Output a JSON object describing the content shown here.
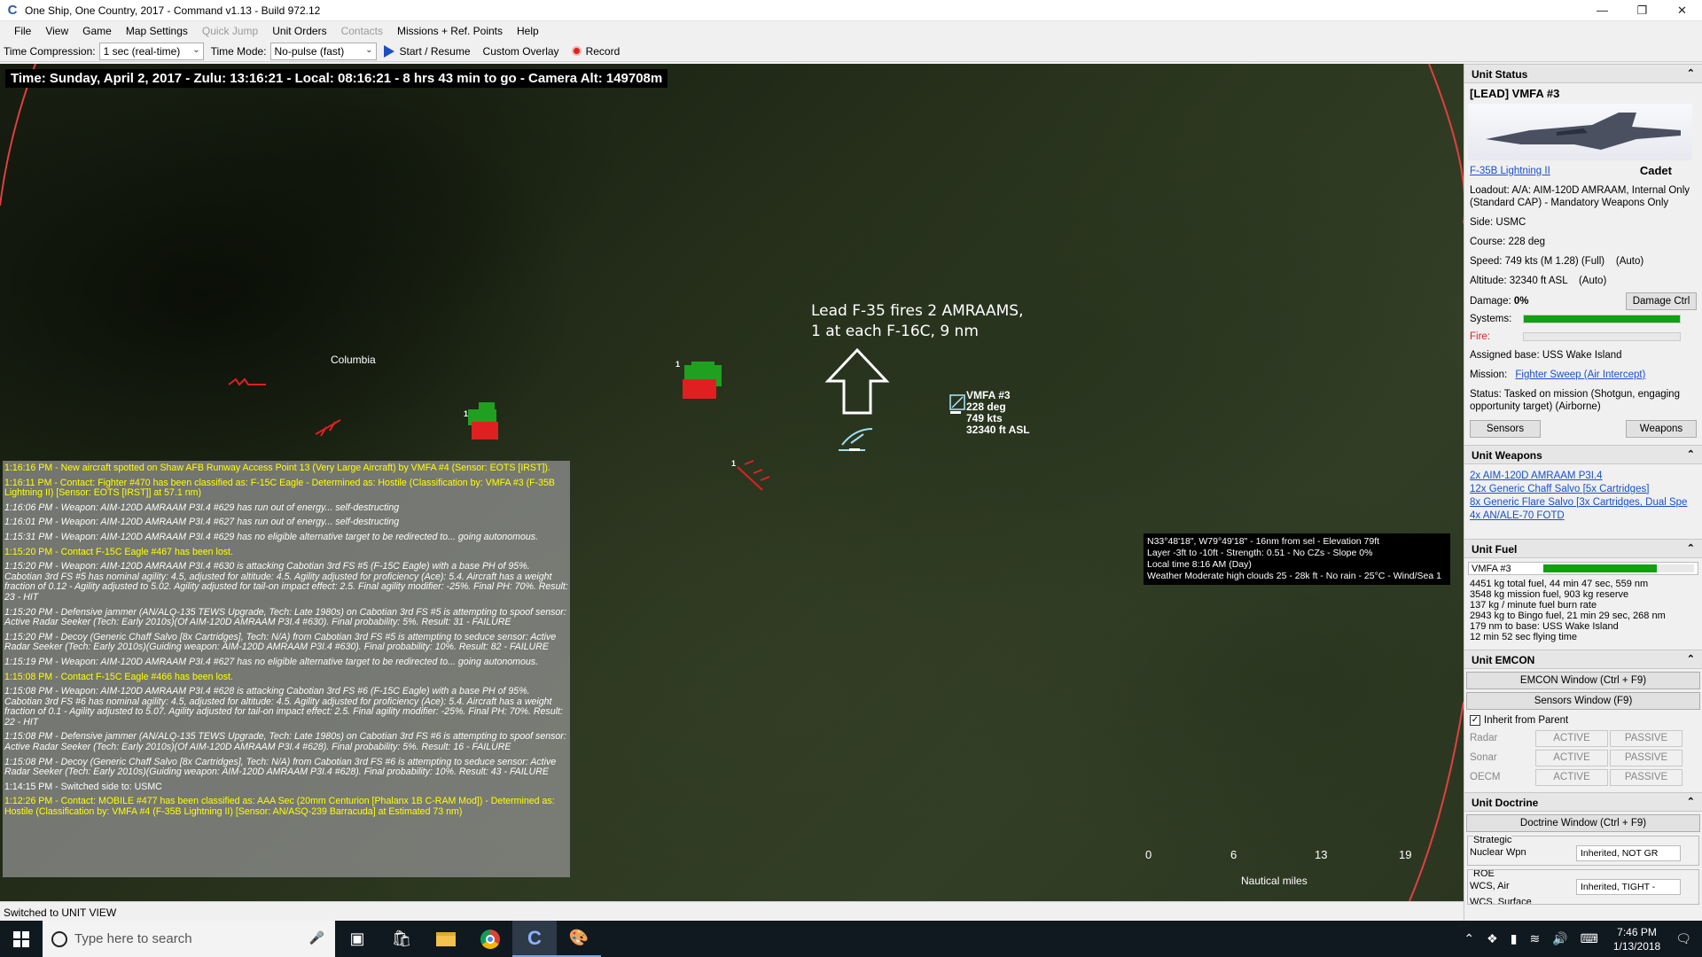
{
  "window": {
    "app_icon": "command-c-icon",
    "title": "One Ship, One Country, 2017 - Command v1.13 - Build 972.12"
  },
  "menu": [
    "File",
    "View",
    "Game",
    "Map Settings",
    "Quick Jump",
    "Unit Orders",
    "Contacts",
    "Missions + Ref. Points",
    "Help"
  ],
  "menu_disabled": [
    "Quick Jump",
    "Contacts"
  ],
  "toolbar": {
    "time_compression_label": "Time Compression:",
    "time_compression_value": "1 sec (real-time)",
    "time_mode_label": "Time Mode:",
    "time_mode_value": "No-pulse (fast)",
    "start_label": "Start / Resume",
    "overlay_label": "Custom Overlay",
    "record_label": "Record"
  },
  "map": {
    "time_bar": "Time: Sunday, April 2, 2017 - Zulu: 13:16:21 - Local: 08:16:21 - 8 hrs 43 min to go -  Camera Alt: 149708m",
    "city_label": "Columbia",
    "annotation_line1": "Lead F-35 fires 2 AMRAAMS,",
    "annotation_line2": "1 at each F-16C, 9 nm",
    "unit_label": {
      "name": "VMFA #3",
      "heading": "228 deg",
      "speed": "749 kts",
      "altitude": "32340 ft ASL"
    },
    "group_counts": [
      "1",
      "1",
      "1"
    ],
    "info_box": [
      "N33°48'18\", W79°49'18\" - 16nm from sel - Elevation 79ft",
      "Layer -3ft to -10ft - Strength: 0.51 - No CZs - Slope 0%",
      "Local time 8:16 AM (Day)",
      "Weather Moderate high clouds 25 - 28k ft - No rain - 25°C - Wind/Sea 1"
    ],
    "scale": {
      "ticks": [
        "0",
        "6",
        "13",
        "19"
      ],
      "unit": "Nautical miles"
    }
  },
  "log": [
    {
      "c": "y",
      "t": "1:16:16 PM - New aircraft spotted on Shaw AFB Runway Access Point 13 (Very Large Aircraft) by VMFA #4 (Sensor: EOTS [IRST])."
    },
    {
      "c": "y",
      "t": "1:16:11 PM - Contact: Fighter #470 has been classified as: F-15C Eagle - Determined as: Hostile (Classification by: VMFA #3 (F-35B Lightning II) [Sensor: EOTS [IRST]] at 57.1 nm)"
    },
    {
      "c": "i",
      "t": "1:16:06 PM - Weapon: AIM-120D AMRAAM P3I.4 #629 has run out of energy... self-destructing"
    },
    {
      "c": "i",
      "t": "1:16:01 PM - Weapon: AIM-120D AMRAAM P3I.4 #627 has run out of energy... self-destructing"
    },
    {
      "c": "i",
      "t": "1:15:31 PM - Weapon: AIM-120D AMRAAM P3I.4 #629 has no eligible alternative target to be redirected to... going autonomous."
    },
    {
      "c": "y",
      "t": "1:15:20 PM - Contact F-15C Eagle #467 has been lost."
    },
    {
      "c": "i",
      "t": "1:15:20 PM - Weapon: AIM-120D AMRAAM P3I.4 #630 is attacking Cabotian 3rd FS #5 (F-15C Eagle) with a base PH of 95%. Cabotian 3rd FS #5 has nominal agility: 4.5, adjusted for altitude: 4.5. Agility adjusted for proficiency (Ace): 5.4. Aircraft has a weight fraction of 0.12 - Agility adjusted to 5.02. Agility adjusted for tail-on impact effect: 2.5. Final agility modifier: -25%. Final PH: 70%. Result: 23 - HIT"
    },
    {
      "c": "i",
      "t": "1:15:20 PM - Defensive jammer (AN/ALQ-135 TEWS Upgrade, Tech: Late 1980s) on Cabotian 3rd FS #5 is attempting to spoof sensor: Active Radar Seeker (Tech: Early 2010s)(Of AIM-120D AMRAAM P3I.4 #630). Final probability: 5%. Result: 31 - FAILURE"
    },
    {
      "c": "i",
      "t": "1:15:20 PM - Decoy (Generic Chaff Salvo [8x Cartridges], Tech: N/A) from Cabotian 3rd FS #5 is attempting to seduce sensor: Active Radar Seeker (Tech: Early 2010s)(Guiding weapon: AIM-120D AMRAAM P3I.4 #630). Final probability: 10%. Result: 82 - FAILURE"
    },
    {
      "c": "i",
      "t": "1:15:19 PM - Weapon: AIM-120D AMRAAM P3I.4 #627 has no eligible alternative target to be redirected to... going autonomous."
    },
    {
      "c": "y",
      "t": "1:15:08 PM - Contact F-15C Eagle #466 has been lost."
    },
    {
      "c": "i",
      "t": "1:15:08 PM - Weapon: AIM-120D AMRAAM P3I.4 #628 is attacking Cabotian 3rd FS #6 (F-15C Eagle) with a base PH of 95%. Cabotian 3rd FS #6 has nominal agility: 4.5, adjusted for altitude: 4.5. Agility adjusted for proficiency (Ace): 5.4. Aircraft has a weight fraction of 0.1 - Agility adjusted to 5.07. Agility adjusted for tail-on impact effect: 2.5. Final agility modifier: -25%. Final PH: 70%. Result: 22 - HIT"
    },
    {
      "c": "i",
      "t": "1:15:08 PM - Defensive jammer (AN/ALQ-135 TEWS Upgrade, Tech: Late 1980s) on Cabotian 3rd FS #6 is attempting to spoof sensor: Active Radar Seeker (Tech: Early 2010s)(Of AIM-120D AMRAAM P3I.4 #628). Final probability: 5%. Result: 16 - FAILURE"
    },
    {
      "c": "i",
      "t": "1:15:08 PM - Decoy (Generic Chaff Salvo [8x Cartridges], Tech: N/A) from Cabotian 3rd FS #6 is attempting to seduce sensor: Active Radar Seeker (Tech: Early 2010s)(Guiding weapon: AIM-120D AMRAAM P3I.4 #628). Final probability: 10%. Result: 43 - FAILURE"
    },
    {
      "c": "w",
      "t": "1:14:15 PM - Switched side to: USMC"
    },
    {
      "c": "y",
      "t": "1:12:26 PM - Contact: MOBILE #477 has been classified as: AAA Sec (20mm Centurion [Phalanx 1B C-RAM Mod]) - Determined as: Hostile (Classification by: VMFA #4 (F-35B Lightning II) [Sensor: AN/ASQ-239 Barracuda] at Estimated 73 nm)"
    }
  ],
  "status_bar": "Switched to UNIT VIEW",
  "panel": {
    "unit_status": {
      "header": "Unit Status",
      "unit_name": "[LEAD] VMFA #3",
      "aircraft_link": "F-35B Lightning II",
      "proficiency": "Cadet",
      "loadout": "Loadout: A/A: AIM-120D AMRAAM, Internal Only (Standard CAP) - Mandatory Weapons Only",
      "side": "Side: USMC",
      "course": "Course: 228 deg",
      "speed": "Speed: 749 kts (M 1.28) (Full)    (Auto)",
      "altitude": "Altitude: 32340 ft ASL    (Auto)",
      "damage_label": "Damage:",
      "damage_value": "0%",
      "damage_ctrl": "Damage Ctrl",
      "systems_label": "Systems:",
      "systems_level": 1.0,
      "fire_label": "Fire:",
      "fire_level": 0.0,
      "assigned_base": "Assigned base: USS Wake Island",
      "mission_label": "Mission:",
      "mission_link": "Fighter Sweep (Air Intercept)",
      "status": "Status: Tasked on mission (Shotgun, engaging opportunity target) (Airborne)",
      "sensors_btn": "Sensors",
      "weapons_btn": "Weapons"
    },
    "unit_weapons": {
      "header": "Unit Weapons",
      "items": [
        "2x AIM-120D AMRAAM P3I.4",
        "12x Generic Chaff Salvo [5x Cartridges]",
        "8x Generic Flare Salvo [3x Cartridges, Dual Spe",
        "4x AN/ALE-70 FOTD"
      ]
    },
    "unit_fuel": {
      "header": "Unit Fuel",
      "bar_label": "VMFA #3",
      "fuel_level": 0.75,
      "lines": [
        "4451 kg total fuel, 44 min 47 sec, 559 nm",
        "3548 kg mission fuel, 903 kg reserve",
        "137 kg / minute fuel burn rate",
        "2943 kg to Bingo fuel, 21 min 29 sec, 268 nm",
        "179 nm to base: USS Wake Island",
        "12 min 52 sec flying time"
      ]
    },
    "unit_emcon": {
      "header": "Unit EMCON",
      "emcon_btn": "EMCON Window (Ctrl + F9)",
      "sensors_btn": "Sensors Window (F9)",
      "inherit": "Inherit from Parent",
      "rows": [
        {
          "name": "Radar",
          "active": "ACTIVE",
          "passive": "PASSIVE"
        },
        {
          "name": "Sonar",
          "active": "ACTIVE",
          "passive": "PASSIVE"
        },
        {
          "name": "OECM",
          "active": "ACTIVE",
          "passive": "PASSIVE"
        }
      ]
    },
    "unit_doctrine": {
      "header": "Unit Doctrine",
      "doctrine_btn": "Doctrine Window (Ctrl + F9)",
      "strategic_label": "Strategic",
      "nuclear_label": "Nuclear Wpn",
      "nuclear_value": "Inherited, NOT GR",
      "roe_label": "ROE",
      "wcs_air_label": "WCS, Air",
      "wcs_air_value": "Inherited, TIGHT -",
      "wcs_surface_label": "WCS, Surface"
    }
  },
  "taskbar": {
    "search_placeholder": "Type here to search",
    "time": "7:46 PM",
    "date": "1/13/2018"
  }
}
